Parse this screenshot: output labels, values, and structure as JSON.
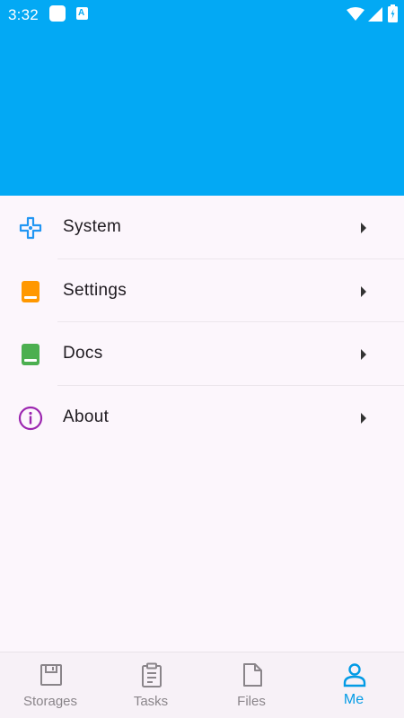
{
  "status_bar": {
    "time": "3:32",
    "notif_letter": "A"
  },
  "menu": [
    {
      "label": "System",
      "icon": "system-icon",
      "color": "#2196f3"
    },
    {
      "label": "Settings",
      "icon": "settings-book-icon",
      "color": "#ff9800"
    },
    {
      "label": "Docs",
      "icon": "docs-book-icon",
      "color": "#4caf50"
    },
    {
      "label": "About",
      "icon": "info-icon",
      "color": "#9c27b0"
    }
  ],
  "bottom_nav": [
    {
      "label": "Storages",
      "icon": "storage-icon",
      "active": false
    },
    {
      "label": "Tasks",
      "icon": "clipboard-icon",
      "active": false
    },
    {
      "label": "Files",
      "icon": "file-icon",
      "active": false
    },
    {
      "label": "Me",
      "icon": "person-icon",
      "active": true
    }
  ],
  "colors": {
    "primary": "#03a9f4",
    "active_nav": "#039be5",
    "background": "#fcf6fc"
  }
}
